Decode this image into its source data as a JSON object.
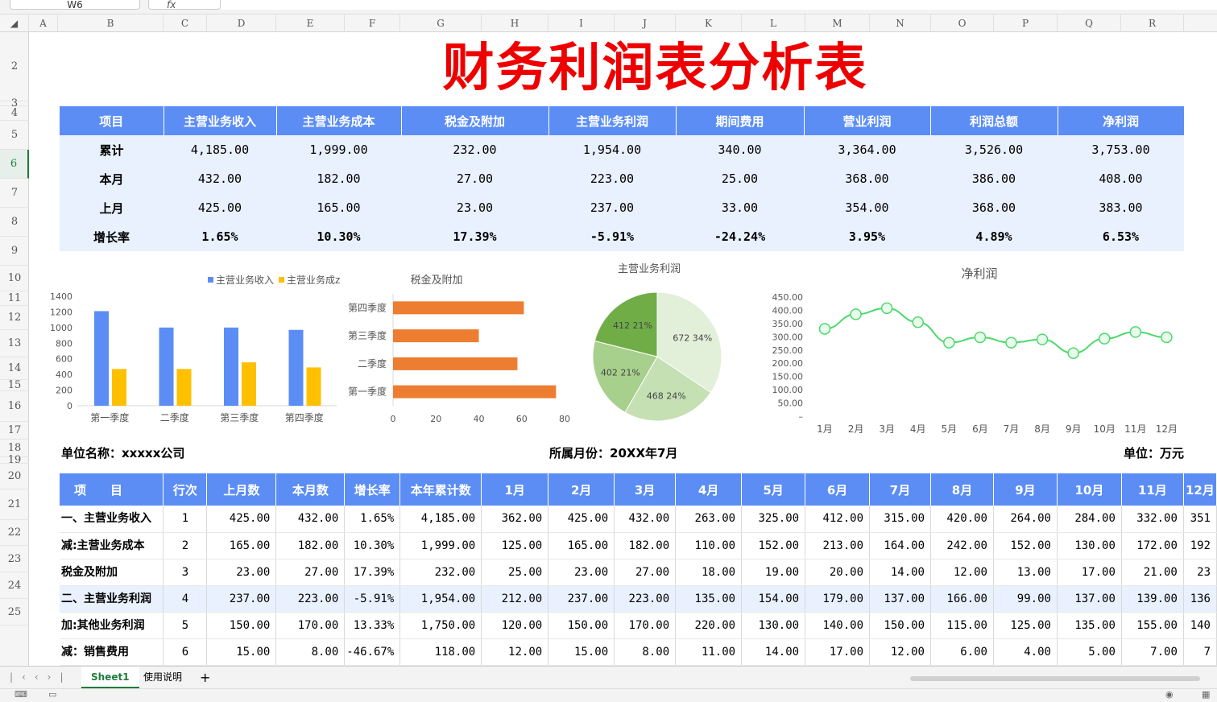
{
  "formula_bar": {
    "cell_ref": "W6",
    "fx_label": "fx"
  },
  "columns": [
    "A",
    "B",
    "C",
    "D",
    "E",
    "F",
    "G",
    "H",
    "I",
    "J",
    "K",
    "L",
    "M",
    "N",
    "O",
    "P",
    "Q",
    "R"
  ],
  "rows": [
    "2",
    "3",
    "4",
    "5",
    "6",
    "7",
    "8",
    "9",
    "10",
    "11",
    "12",
    "13",
    "14",
    "15",
    "16",
    "17",
    "18",
    "19",
    "20",
    "21",
    "22",
    "23",
    "24",
    "25"
  ],
  "title": "财务利润表分析表",
  "summary": {
    "headers": [
      "项目",
      "主营业务收入",
      "主营业务成本",
      "税金及附加",
      "主营业务利润",
      "期间费用",
      "营业利润",
      "利润总额",
      "净利润"
    ],
    "rows": [
      [
        "累计",
        "4,185.00",
        "1,999.00",
        "232.00",
        "1,954.00",
        "340.00",
        "3,364.00",
        "3,526.00",
        "3,753.00"
      ],
      [
        "本月",
        "432.00",
        "182.00",
        "27.00",
        "223.00",
        "25.00",
        "368.00",
        "386.00",
        "408.00"
      ],
      [
        "上月",
        "425.00",
        "165.00",
        "23.00",
        "237.00",
        "33.00",
        "354.00",
        "368.00",
        "383.00"
      ],
      [
        "增长率",
        "1.65%",
        "10.30%",
        "17.39%",
        "-5.91%",
        "-24.24%",
        "3.95%",
        "4.89%",
        "6.53%"
      ]
    ]
  },
  "chart_data": [
    {
      "type": "bar",
      "title": "",
      "categories": [
        "第一季度",
        "二季度",
        "第三季度",
        "第四季度"
      ],
      "series": [
        {
          "name": "主营业务收入",
          "values": [
            1210,
            1000,
            1000,
            970
          ],
          "color": "#5b8df5"
        },
        {
          "name": "主营业务成本",
          "values": [
            470,
            470,
            555,
            490
          ],
          "color": "#ffc000"
        }
      ],
      "legend_text": [
        "主营业务收入",
        "主营业务成z"
      ],
      "ylim": [
        0,
        1400
      ],
      "yticks": [
        "0",
        "200",
        "400",
        "600",
        "800",
        "1000",
        "1200",
        "1400"
      ],
      "legend": "top"
    },
    {
      "type": "bar",
      "orientation": "horizontal",
      "title": "税金及附加",
      "categories": [
        "第四季度",
        "第三季度",
        "二季度",
        "第一季度"
      ],
      "values": [
        61,
        40,
        58,
        76
      ],
      "color": "#ed7d31",
      "xlim": [
        0,
        80
      ],
      "xticks": [
        "0",
        "20",
        "40",
        "60",
        "80"
      ]
    },
    {
      "type": "pie",
      "title": "主营业务利润",
      "slices": [
        {
          "value": 672,
          "label": "672",
          "percent": "34%",
          "color": "#e2efd9"
        },
        {
          "value": 468,
          "label": "468",
          "percent": "24%",
          "color": "#c5e0b3"
        },
        {
          "value": 402,
          "label": "402",
          "percent": "21%",
          "color": "#a8d08d"
        },
        {
          "value": 412,
          "label": "412",
          "percent": "21%",
          "color": "#70ad47"
        }
      ]
    },
    {
      "type": "line",
      "title": "净利润",
      "x": [
        "1月",
        "2月",
        "3月",
        "4月",
        "5月",
        "6月",
        "7月",
        "8月",
        "9月",
        "10月",
        "11月",
        "12月"
      ],
      "values": [
        330,
        385,
        408,
        355,
        278,
        298,
        278,
        290,
        238,
        293,
        318,
        298
      ],
      "ylim": [
        0,
        450
      ],
      "yticks": [
        "–",
        "50.00",
        "100.00",
        "150.00",
        "200.00",
        "250.00",
        "300.00",
        "350.00",
        "400.00",
        "450.00"
      ],
      "color": "#4cd96b"
    }
  ],
  "meta": {
    "unit_name": "单位名称：xxxxx公司",
    "month": "所属月份：20XX年7月",
    "unit": "单位：万元"
  },
  "detail": {
    "headers": [
      "项　　目",
      "行次",
      "上月数",
      "本月数",
      "增长率",
      "本年累计数",
      "1月",
      "2月",
      "3月",
      "4月",
      "5月",
      "6月",
      "7月",
      "8月",
      "9月",
      "10月",
      "11月",
      "12月"
    ],
    "rows": [
      [
        "一、主营业务收入",
        "1",
        "425.00",
        "432.00",
        "1.65%",
        "4,185.00",
        "362.00",
        "425.00",
        "432.00",
        "263.00",
        "325.00",
        "412.00",
        "315.00",
        "420.00",
        "264.00",
        "284.00",
        "332.00",
        "351"
      ],
      [
        "减:主营业务成本",
        "2",
        "165.00",
        "182.00",
        "10.30%",
        "1,999.00",
        "125.00",
        "165.00",
        "182.00",
        "110.00",
        "152.00",
        "213.00",
        "164.00",
        "242.00",
        "152.00",
        "130.00",
        "172.00",
        "192"
      ],
      [
        "税金及附加",
        "3",
        "23.00",
        "27.00",
        "17.39%",
        "232.00",
        "25.00",
        "23.00",
        "27.00",
        "18.00",
        "19.00",
        "20.00",
        "14.00",
        "12.00",
        "13.00",
        "17.00",
        "21.00",
        "23"
      ],
      [
        "二、主营业务利润",
        "4",
        "237.00",
        "223.00",
        "-5.91%",
        "1,954.00",
        "212.00",
        "237.00",
        "223.00",
        "135.00",
        "154.00",
        "179.00",
        "137.00",
        "166.00",
        "99.00",
        "137.00",
        "139.00",
        "136"
      ],
      [
        "加:其他业务利润",
        "5",
        "150.00",
        "170.00",
        "13.33%",
        "1,750.00",
        "120.00",
        "150.00",
        "170.00",
        "220.00",
        "130.00",
        "140.00",
        "150.00",
        "115.00",
        "125.00",
        "135.00",
        "155.00",
        "140"
      ],
      [
        "减：销售费用",
        "6",
        "15.00",
        "8.00",
        "-46.67%",
        "118.00",
        "12.00",
        "15.00",
        "8.00",
        "11.00",
        "14.00",
        "17.00",
        "12.00",
        "6.00",
        "4.00",
        "5.00",
        "7.00",
        "7"
      ]
    ]
  },
  "sheet_tabs": {
    "active": "Sheet1",
    "other": "使用说明",
    "add": "+"
  }
}
